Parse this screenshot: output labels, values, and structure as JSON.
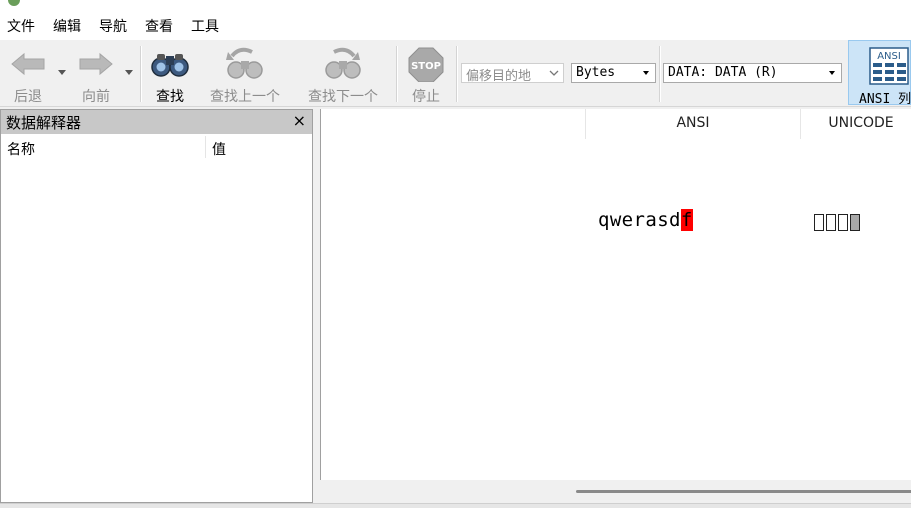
{
  "menu": {
    "items": [
      {
        "label": "文件"
      },
      {
        "label": "编辑"
      },
      {
        "label": "导航"
      },
      {
        "label": "查看"
      },
      {
        "label": "工具"
      }
    ]
  },
  "toolbar": {
    "back_label": "后退",
    "forward_label": "向前",
    "find_label": "查找",
    "find_prev_label": "查找上一个",
    "find_next_label": "查找下一个",
    "stop_label": "停止",
    "stop_icon_text": "STOP",
    "offset_select_value": "偏移目的地",
    "unit_select_value": "Bytes",
    "data_select_value": "DATA: DATA (R)",
    "ansi_button_label": "ANSI 列",
    "ansi_icon_text": "ANSI"
  },
  "interpreter": {
    "title": "数据解释器",
    "close_glyph": "×",
    "columns": {
      "name": "名称",
      "value": "值"
    }
  },
  "hex": {
    "columns": {
      "ansi": "ANSI",
      "unicode": "UNICODE"
    },
    "ansi_text": "qwerasd",
    "ansi_selected_char": "f",
    "unicode_box_count": 3
  },
  "colors": {
    "selection_red": "#ff0000",
    "selection_gray": "#a8a8a8",
    "ansi_button_bg": "#cce4f7"
  }
}
